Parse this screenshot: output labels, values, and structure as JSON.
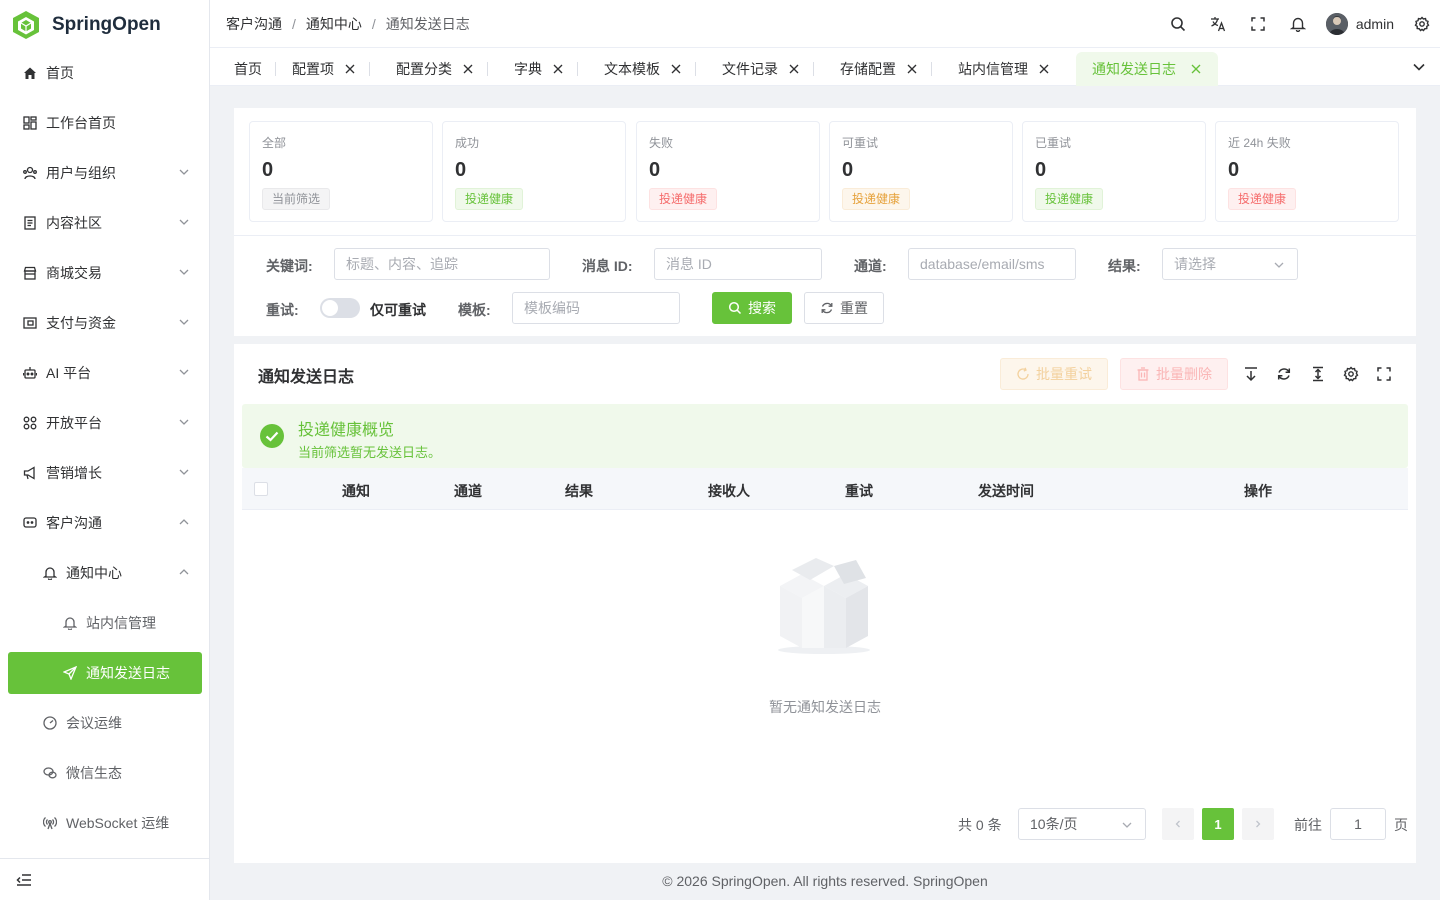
{
  "app": {
    "name": "SpringOpen",
    "brand_color": "#67c23a"
  },
  "sidebar": {
    "items": [
      {
        "label": "首页",
        "icon": "home-icon"
      },
      {
        "label": "工作台首页",
        "icon": "dashboard-icon"
      },
      {
        "label": "用户与组织",
        "icon": "users-icon",
        "expandable": true
      },
      {
        "label": "内容社区",
        "icon": "document-icon",
        "expandable": true
      },
      {
        "label": "商城交易",
        "icon": "store-icon",
        "expandable": true
      },
      {
        "label": "支付与资金",
        "icon": "wallet-icon",
        "expandable": true
      },
      {
        "label": "AI 平台",
        "icon": "robot-icon",
        "expandable": true
      },
      {
        "label": "开放平台",
        "icon": "grid-icon",
        "expandable": true
      },
      {
        "label": "营销增长",
        "icon": "megaphone-icon",
        "expandable": true
      },
      {
        "label": "客户沟通",
        "icon": "chat-icon",
        "expanded": true
      },
      {
        "label": "通知中心",
        "icon": "bell-icon",
        "expanded": true
      },
      {
        "label": "站内信管理",
        "icon": "bell-icon"
      },
      {
        "label": "通知发送日志",
        "icon": "send-icon",
        "active": true
      },
      {
        "label": "会议运维",
        "icon": "meter-icon"
      },
      {
        "label": "微信生态",
        "icon": "wechat-icon"
      },
      {
        "label": "WebSocket 运维",
        "icon": "broadcast-icon"
      }
    ]
  },
  "header": {
    "breadcrumb": [
      "客户沟通",
      "通知中心",
      "通知发送日志"
    ],
    "separator": "/",
    "user": "admin"
  },
  "tabs": [
    {
      "label": "首页",
      "closable": false
    },
    {
      "label": "配置项",
      "closable": true
    },
    {
      "label": "配置分类",
      "closable": true
    },
    {
      "label": "字典",
      "closable": true
    },
    {
      "label": "文本模板",
      "closable": true
    },
    {
      "label": "文件记录",
      "closable": true
    },
    {
      "label": "存储配置",
      "closable": true
    },
    {
      "label": "站内信管理",
      "closable": true
    },
    {
      "label": "通知发送日志",
      "closable": true,
      "active": true
    }
  ],
  "stats": [
    {
      "label": "全部",
      "value": "0",
      "tag": "当前筛选",
      "tag_type": "gray"
    },
    {
      "label": "成功",
      "value": "0",
      "tag": "投递健康",
      "tag_type": "green"
    },
    {
      "label": "失败",
      "value": "0",
      "tag": "投递健康",
      "tag_type": "red"
    },
    {
      "label": "可重试",
      "value": "0",
      "tag": "投递健康",
      "tag_type": "orange"
    },
    {
      "label": "已重试",
      "value": "0",
      "tag": "投递健康",
      "tag_type": "green"
    },
    {
      "label": "近 24h 失败",
      "value": "0",
      "tag": "投递健康",
      "tag_type": "red"
    }
  ],
  "filters": {
    "keyword_label": "关键词:",
    "keyword_placeholder": "标题、内容、追踪",
    "msgid_label": "消息 ID:",
    "msgid_placeholder": "消息 ID",
    "channel_label": "通道:",
    "channel_placeholder": "database/email/sms",
    "result_label": "结果:",
    "result_placeholder": "请选择",
    "retry_label": "重试:",
    "retry_switch_label": "仅可重试",
    "template_label": "模板:",
    "template_placeholder": "模板编码",
    "search_button": "搜索",
    "reset_button": "重置"
  },
  "table_section": {
    "title": "通知发送日志",
    "batch_retry": "批量重试",
    "batch_delete": "批量删除",
    "alert_title": "投递健康概览",
    "alert_desc": "当前筛选暂无发送日志。",
    "columns": [
      "通知",
      "通道",
      "结果",
      "接收人",
      "重试",
      "发送时间",
      "操作"
    ],
    "empty_text": "暂无通知发送日志"
  },
  "pagination": {
    "total": "共 0 条",
    "page_size": "10条/页",
    "current_page": "1",
    "goto_label": "前往",
    "goto_value": "1",
    "page_suffix": "页"
  },
  "footer": "© 2026 SpringOpen. All rights reserved. SpringOpen"
}
